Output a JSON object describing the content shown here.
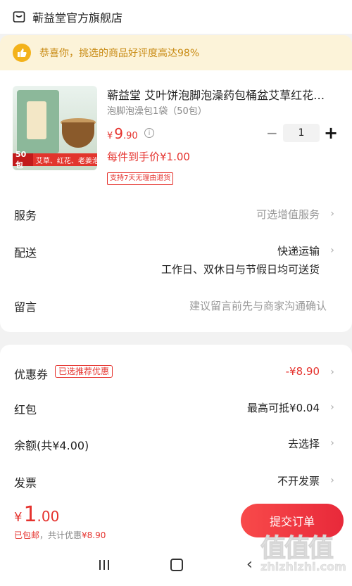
{
  "store": {
    "name": "蕲益堂官方旗舰店",
    "icon": "store-icon"
  },
  "banner": {
    "text": "恭喜你，挑选的商品好评度高达98%",
    "icon": "thumbs-up-icon",
    "color": "#c88a12",
    "background": "#fcf3d9"
  },
  "product": {
    "title": "蕲益堂 艾叶饼泡脚泡澡药包桶盆艾草红花…",
    "sku": "泡脚泡澡包1袋（50包）",
    "image_tag_count": "50包",
    "image_tag_text": "艾草、红花、老姜泡脚粉",
    "price_symbol": "¥",
    "price_int": "9",
    "price_dec": ".90",
    "quantity": "1",
    "qty_minus": "−",
    "qty_plus": "+",
    "unit_price": "每件到手价¥1.00",
    "return_badge": "支持7天无理由退货"
  },
  "rows1": {
    "service": {
      "label": "服务",
      "value": "可选增值服务"
    },
    "delivery": {
      "label": "配送",
      "value": "快递运输",
      "note": "工作日、双休日与节假日均可送货"
    },
    "message": {
      "label": "留言",
      "placeholder": "建议留言前先与商家沟通确认"
    }
  },
  "rows2": {
    "coupon": {
      "label": "优惠券",
      "tag": "已选推荐优惠",
      "value": "-¥8.90"
    },
    "redpacket": {
      "label": "红包",
      "value": "最高可抵¥0.04"
    },
    "balance": {
      "label": "余额(共¥4.00)",
      "value": "去选择"
    },
    "invoice": {
      "label": "发票",
      "value": "不开发票"
    }
  },
  "footer": {
    "total_symbol": "¥",
    "total_int": "1",
    "total_dec": ".00",
    "shipping": "已包邮",
    "discount_note": "，共计优惠",
    "discount_value": "¥8.90",
    "submit_label": "提交订单"
  },
  "nav": {
    "menu_icon": "recent-apps-icon",
    "home_icon": "home-icon",
    "back_icon": "back-icon",
    "back_glyph": "‹"
  },
  "watermark": {
    "glyphs": "值值值",
    "url": "zhizhizhi.com"
  },
  "colors": {
    "accent": "#e5322d",
    "muted": "#999999"
  }
}
